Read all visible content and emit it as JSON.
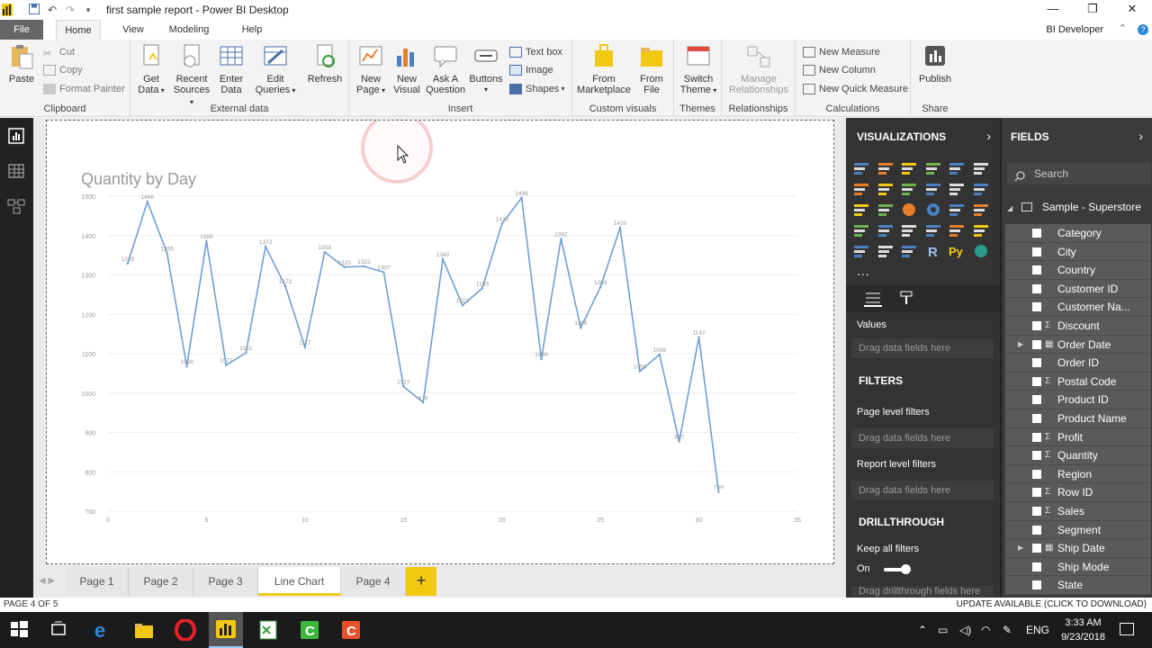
{
  "window": {
    "title": "first sample report - Power BI Desktop",
    "controls": [
      "minimize-icon",
      "maximize-icon",
      "close-icon"
    ]
  },
  "menu": {
    "file": "File",
    "tabs": [
      "Home",
      "View",
      "Modeling",
      "Help"
    ],
    "active_tab": "Home",
    "user": "BI Developer"
  },
  "ribbon": {
    "clipboard": {
      "paste": "Paste",
      "cut": "Cut",
      "copy": "Copy",
      "format_painter": "Format Painter",
      "label": "Clipboard"
    },
    "external": {
      "get_data": "Get\nData",
      "recent_sources": "Recent\nSources",
      "enter_data": "Enter\nData",
      "edit_queries": "Edit\nQueries",
      "refresh": "Refresh",
      "label": "External data"
    },
    "insert": {
      "new_page": "New\nPage",
      "new_visual": "New\nVisual",
      "ask_question": "Ask A\nQuestion",
      "buttons": "Buttons",
      "text_box": "Text box",
      "image": "Image",
      "shapes": "Shapes",
      "label": "Insert"
    },
    "custom": {
      "from_marketplace": "From\nMarketplace",
      "from_file": "From\nFile",
      "label": "Custom visuals"
    },
    "themes": {
      "switch_theme": "Switch\nTheme",
      "label": "Themes"
    },
    "relationships": {
      "manage": "Manage\nRelationships",
      "label": "Relationships"
    },
    "calculations": {
      "new_measure": "New Measure",
      "new_column": "New Column",
      "new_quick_measure": "New Quick Measure",
      "label": "Calculations"
    },
    "share": {
      "publish": "Publish",
      "label": "Share"
    }
  },
  "pages": {
    "tabs": [
      "Page 1",
      "Page 2",
      "Page 3",
      "Line Chart",
      "Page 4"
    ],
    "active": "Line Chart",
    "add": "+",
    "status": "PAGE 4 OF 5",
    "update": "UPDATE AVAILABLE (CLICK TO DOWNLOAD)"
  },
  "visualizations": {
    "header": "VISUALIZATIONS",
    "values_label": "Values",
    "drag_here": "Drag data fields here",
    "filters_header": "FILTERS",
    "page_filters": "Page level filters",
    "report_filters": "Report level filters",
    "drill_header": "DRILLTHROUGH",
    "keep_filters": "Keep all filters",
    "keep_state": "On",
    "drill_drag": "Drag drillthrough fields here",
    "more": "..."
  },
  "fields": {
    "header": "FIELDS",
    "search_placeholder": "Search",
    "table": "Sample - Superstore",
    "items": [
      {
        "name": "Category",
        "sigma": false,
        "hierarchy": false
      },
      {
        "name": "City",
        "sigma": false,
        "hierarchy": false
      },
      {
        "name": "Country",
        "sigma": false,
        "hierarchy": false
      },
      {
        "name": "Customer ID",
        "sigma": false,
        "hierarchy": false
      },
      {
        "name": "Customer Na...",
        "sigma": false,
        "hierarchy": false
      },
      {
        "name": "Discount",
        "sigma": true,
        "hierarchy": false
      },
      {
        "name": "Order Date",
        "sigma": false,
        "hierarchy": true
      },
      {
        "name": "Order ID",
        "sigma": false,
        "hierarchy": false
      },
      {
        "name": "Postal Code",
        "sigma": true,
        "hierarchy": false
      },
      {
        "name": "Product ID",
        "sigma": false,
        "hierarchy": false
      },
      {
        "name": "Product Name",
        "sigma": false,
        "hierarchy": false
      },
      {
        "name": "Profit",
        "sigma": true,
        "hierarchy": false
      },
      {
        "name": "Quantity",
        "sigma": true,
        "hierarchy": false
      },
      {
        "name": "Region",
        "sigma": false,
        "hierarchy": false
      },
      {
        "name": "Row ID",
        "sigma": true,
        "hierarchy": false
      },
      {
        "name": "Sales",
        "sigma": true,
        "hierarchy": false
      },
      {
        "name": "Segment",
        "sigma": false,
        "hierarchy": false
      },
      {
        "name": "Ship Date",
        "sigma": false,
        "hierarchy": true
      },
      {
        "name": "Ship Mode",
        "sigma": false,
        "hierarchy": false
      },
      {
        "name": "State",
        "sigma": false,
        "hierarchy": false
      }
    ]
  },
  "taskbar": {
    "lang": "ENG",
    "time": "3:33 AM",
    "date": "9/23/2018"
  },
  "colors": {
    "accent": "#f2c811",
    "line": "#6f9ed4",
    "pane": "#333333"
  },
  "chart_data": {
    "type": "line",
    "title": "Quantity by Day",
    "xlabel": "",
    "ylabel": "",
    "xlim": [
      0,
      35
    ],
    "ylim": [
      700,
      1500
    ],
    "xticks": [
      0,
      5,
      10,
      15,
      20,
      25,
      30,
      35
    ],
    "yticks": [
      700,
      800,
      900,
      1000,
      1100,
      1200,
      1300,
      1400,
      1500
    ],
    "grid": true,
    "series": [
      {
        "x": [
          1,
          2,
          3,
          4,
          5,
          6,
          7,
          8,
          9,
          10,
          11,
          12,
          13,
          14,
          15,
          16,
          17,
          18,
          19,
          20,
          21,
          22,
          23,
          24,
          25,
          26,
          27,
          28,
          29,
          30,
          31
        ],
        "values": [
          1329,
          1486,
          1355,
          1068,
          1386,
          1071,
          1102,
          1372,
          1272,
          1117,
          1358,
          1320,
          1322,
          1307,
          1017,
          976,
          1340,
          1223,
          1266,
          1430,
          1496,
          1086,
          1392,
          1166,
          1269,
          1420,
          1055,
          1098,
          877,
          1142,
          749
        ]
      }
    ]
  }
}
